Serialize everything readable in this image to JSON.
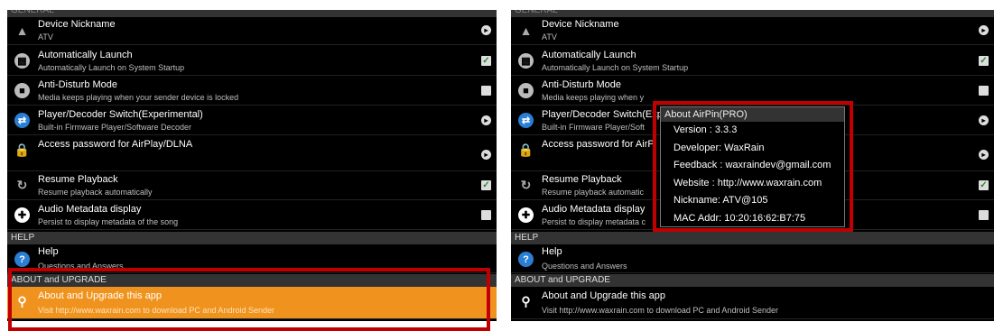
{
  "left": {
    "section_general": "GENERAL",
    "section_help": "HELP",
    "section_about": "ABOUT and UPGRADE",
    "items": [
      {
        "title": "Device Nickname",
        "sub": "ATV",
        "icon": "device-icon",
        "control": "arrow"
      },
      {
        "title": "Automatically Launch",
        "sub": "Automatically Launch on System Startup",
        "icon": "launch-icon",
        "control": "checked"
      },
      {
        "title": "Anti-Disturb Mode",
        "sub": "Media keeps playing when your sender device is locked",
        "icon": "disturb-icon",
        "control": "unchecked"
      },
      {
        "title": "Player/Decoder Switch(Experimental)",
        "sub": "Built-in Firmware Player/Software Decoder",
        "icon": "switch-icon",
        "control": "arrow"
      },
      {
        "title": "Access password for AirPlay/DLNA",
        "sub": "",
        "icon": "lock-icon",
        "control": "arrow"
      },
      {
        "title": "Resume Playback",
        "sub": "Resume playback automatically",
        "icon": "resume-icon",
        "control": "checked"
      },
      {
        "title": "Audio Metadata display",
        "sub": "Persist to display metadata of the song",
        "icon": "metadata-icon",
        "control": "unchecked"
      }
    ],
    "help": {
      "title": "Help",
      "sub": "Questions and Answers"
    },
    "about": {
      "title": "About and Upgrade this app",
      "sub": "Visit http://www.waxrain.com to download PC and Android Sender"
    }
  },
  "right": {
    "section_general": "GENERAL",
    "section_help": "HELP",
    "section_about": "ABOUT and UPGRADE",
    "items": [
      {
        "title": "Device Nickname",
        "sub": "ATV"
      },
      {
        "title": "Automatically Launch",
        "sub": "Automatically Launch on System Startup"
      },
      {
        "title": "Anti-Disturb Mode",
        "sub": "Media keeps playing when y"
      },
      {
        "title": "Player/Decoder Switch(Exp",
        "sub": "Built-in Firmware Player/Soft"
      },
      {
        "title": "Access password for AirPl",
        "sub": ""
      },
      {
        "title": "Resume Playback",
        "sub": "Resume playback automatic"
      },
      {
        "title": "Audio Metadata display",
        "sub": "Persist to display metadata c"
      }
    ],
    "help": {
      "title": "Help",
      "sub": "Questions and Answers"
    },
    "about": {
      "title": "About and Upgrade this app",
      "sub": "Visit http://www.waxrain.com to download PC and Android Sender"
    }
  },
  "dialog": {
    "title": "About AirPin(PRO)",
    "lines": [
      "Version  : 3.3.3",
      "Developer: WaxRain",
      "Feedback : waxraindev@gmail.com",
      "Website  : http://www.waxrain.com",
      "Nickname: ATV@105",
      "MAC Addr: 10:20:16:62:B7:75"
    ]
  },
  "colors": {
    "highlight": "#f0931e",
    "annotation": "#c00000",
    "help_icon": "#2a7fd4"
  }
}
